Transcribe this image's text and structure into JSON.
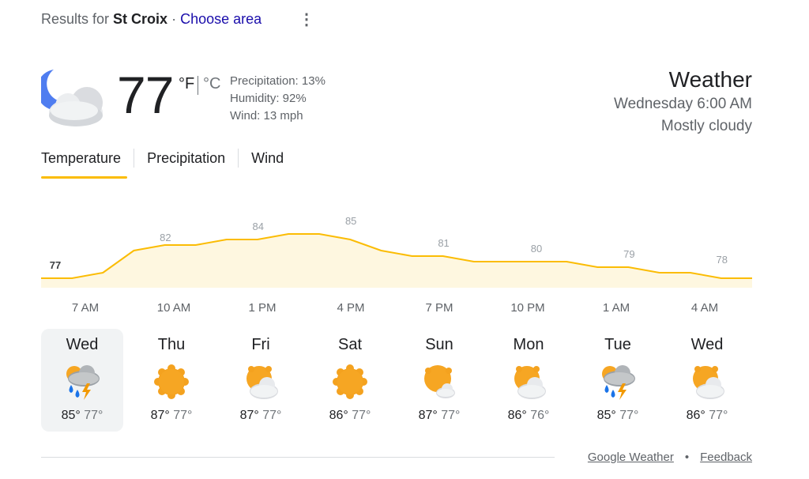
{
  "header": {
    "results_prefix": "Results for",
    "location": "St Croix",
    "separator": "·",
    "choose_area": "Choose area",
    "menu_glyph": "⋮"
  },
  "current": {
    "icon": "moon-cloud-icon",
    "temperature": "77",
    "unit_f": "°F",
    "unit_c": "°C",
    "precipitation": "Precipitation: 13%",
    "humidity": "Humidity: 92%",
    "wind": "Wind: 13 mph",
    "title": "Weather",
    "datetime": "Wednesday 6:00 AM",
    "condition": "Mostly cloudy"
  },
  "tabs": [
    "Temperature",
    "Precipitation",
    "Wind"
  ],
  "hourly": {
    "labels": [
      "77",
      "82",
      "84",
      "85",
      "81",
      "80",
      "79",
      "78"
    ],
    "times": [
      "7 AM",
      "10 AM",
      "1 PM",
      "4 PM",
      "7 PM",
      "10 PM",
      "1 AM",
      "4 AM"
    ]
  },
  "chart_data": {
    "type": "area",
    "series_temps": [
      77,
      77,
      78,
      82,
      83,
      83,
      84,
      84,
      85,
      85,
      84,
      82,
      81,
      81,
      80,
      80,
      80,
      80,
      79,
      79,
      78,
      78,
      77,
      77
    ],
    "labeled_points": [
      77,
      82,
      84,
      85,
      81,
      80,
      79,
      78
    ],
    "x_labels": [
      "7 AM",
      "10 AM",
      "1 PM",
      "4 PM",
      "7 PM",
      "10 PM",
      "1 AM",
      "4 AM"
    ],
    "line_color": "#fbbc04",
    "fill_color": "#fef7e0"
  },
  "days": [
    {
      "name": "Wed",
      "icon": "thunderstorm-icon",
      "high": "85°",
      "low": "77°",
      "selected": true
    },
    {
      "name": "Thu",
      "icon": "sunny-icon",
      "high": "87°",
      "low": "77°"
    },
    {
      "name": "Fri",
      "icon": "partly-cloudy-icon",
      "high": "87°",
      "low": "77°"
    },
    {
      "name": "Sat",
      "icon": "sunny-icon",
      "high": "86°",
      "low": "77°"
    },
    {
      "name": "Sun",
      "icon": "mostly-sunny-icon",
      "high": "87°",
      "low": "77°"
    },
    {
      "name": "Mon",
      "icon": "partly-cloudy-icon",
      "high": "86°",
      "low": "76°"
    },
    {
      "name": "Tue",
      "icon": "thunderstorm-icon",
      "high": "85°",
      "low": "77°"
    },
    {
      "name": "Wed",
      "icon": "partly-cloudy-icon",
      "high": "86°",
      "low": "77°"
    }
  ],
  "footer": {
    "source": "Google Weather",
    "dot": "•",
    "feedback": "Feedback"
  }
}
